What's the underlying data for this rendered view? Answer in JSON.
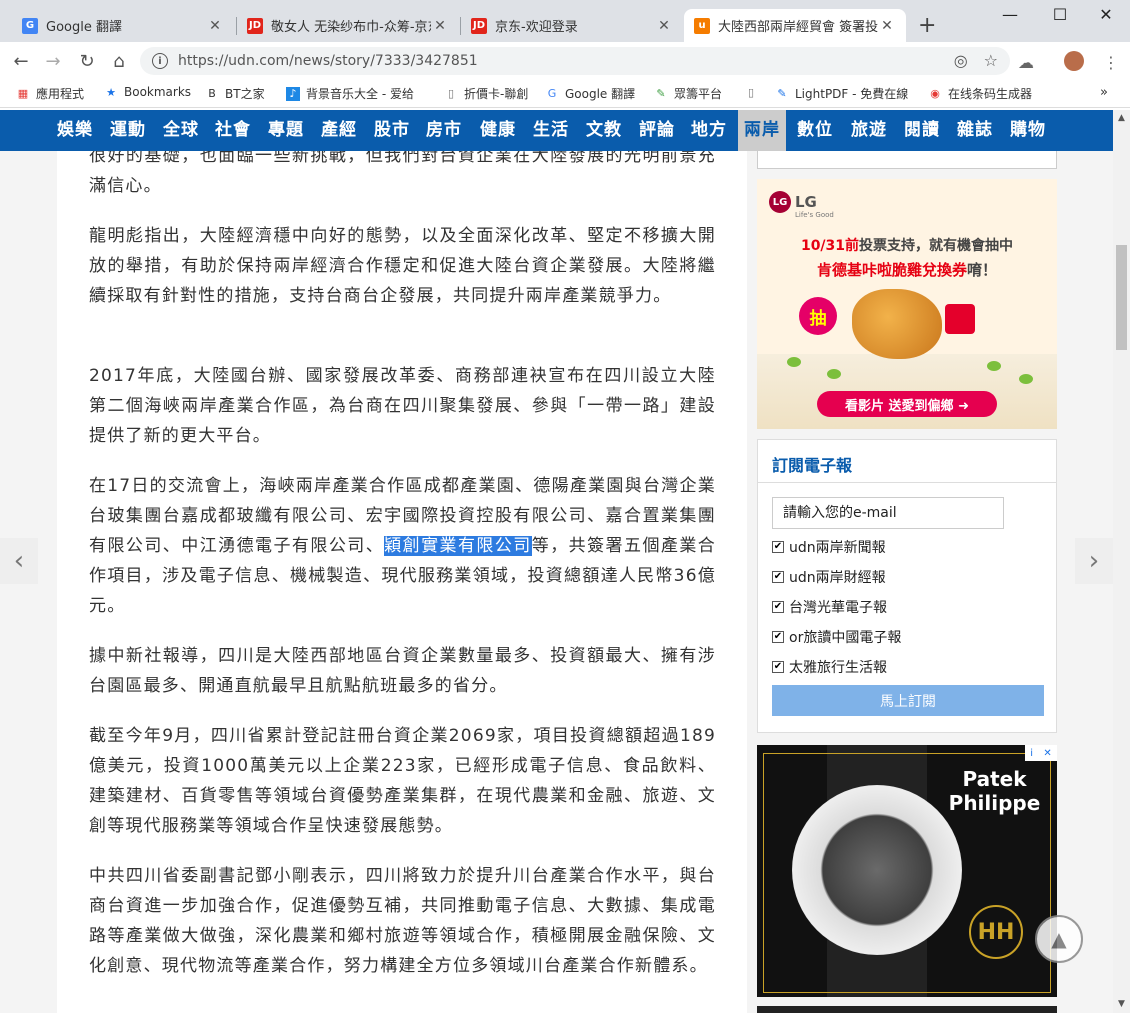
{
  "browser": {
    "tabs": [
      {
        "title": "Google 翻譯",
        "favicon": "google-translate-icon",
        "color": "#4285f4"
      },
      {
        "title": "敬女人 无染纱布巾-众筹-京东",
        "favicon": "jd-icon",
        "color": "#e1251b"
      },
      {
        "title": "京东-欢迎登录",
        "favicon": "jd-icon",
        "color": "#e1251b"
      },
      {
        "title": "大陸西部兩岸經貿會 簽署投資",
        "favicon": "udn-icon",
        "color": "#f57c00"
      }
    ],
    "url": "https://udn.com/news/story/7333/3427851",
    "bookmarks": [
      "應用程式",
      "Bookmarks",
      "BT之家",
      "背景音乐大全 - 爱给",
      "折價卡-聯創",
      "Google 翻譯",
      "眾籌平台",
      "LightPDF - 免費在線",
      "在线条码生成器"
    ]
  },
  "nav": {
    "categories": [
      "娛樂",
      "運動",
      "全球",
      "社會",
      "專題",
      "產經",
      "股市",
      "房市",
      "健康",
      "生活",
      "文教",
      "評論",
      "地方",
      "兩岸",
      "數位",
      "旅遊",
      "閱讀",
      "雜誌",
      "購物"
    ],
    "active": "兩岸"
  },
  "article": {
    "p0": "很好的基礎，也面臨一些新挑戰，但我們對台資企業在大陸發展的光明前景充滿信心。",
    "p1": "龍明彪指出，大陸經濟穩中向好的態勢，以及全面深化改革、堅定不移擴大開放的舉措，有助於保持兩岸經濟合作穩定和促進大陸台資企業發展。大陸將繼續採取有針對性的措施，支持台商台企發展，共同提升兩岸產業競爭力。",
    "p2": "2017年底，大陸國台辦、國家發展改革委、商務部連袂宣布在四川設立大陸第二個海峽兩岸產業合作區，為台商在四川聚集發展、參與「一帶一路」建設提供了新的更大平台。",
    "p3_before": "在17日的交流會上，海峽兩岸產業合作區成都產業園、德陽產業園與台灣企業台玻集團台嘉成都玻纖有限公司、宏宇國際投資控股有限公司、嘉合置業集團有限公司、中江湧德電子有限公司、",
    "p3_highlight": "穎創實業有限公司",
    "p3_after": "等，共簽署五個產業合作項目，涉及電子信息、機械製造、現代服務業領域，投資總額達人民幣36億元。",
    "p4": "據中新社報導，四川是大陸西部地區台資企業數量最多、投資額最大、擁有涉台園區最多、開通直航最早且航點航班最多的省分。",
    "p5": "截至今年9月，四川省累計登記註冊台資企業2069家，項目投資總額超過189億美元，投資1000萬美元以上企業223家，已經形成電子信息、食品飲料、建築建材、百貨零售等領域台資優勢產業集群，在現代農業和金融、旅遊、文創等現代服務業等領域合作呈快速發展態勢。",
    "p6": "中共四川省委副書記鄧小剛表示，四川將致力於提升川台產業合作水平，與台商台資進一步加強合作，促進優勢互補，共同推動電子信息、大數據、集成電路等產業做大做強，深化農業和鄉村旅遊等領域合作，積極開展金融保險、文化創意、現代物流等產業合作，努力構建全方位多領域川台產業合作新體系。"
  },
  "ad_lg": {
    "brand": "LG",
    "tagline": "Life's Good",
    "line1_red": "10/31前",
    "line1_rest": "投票支持，就有機會抽中",
    "line2_red": "肯德基咔啦脆雞兌換券",
    "line2_rest": "唷！",
    "badge": "抽",
    "cta": "看影片 送愛到偏鄉 ➜"
  },
  "subscribe": {
    "title": "訂閱電子報",
    "placeholder": "請輸入您的e-mail",
    "options": [
      "udn兩岸新聞報",
      "udn兩岸財經報",
      "台灣光華電子報",
      "or旅讀中國電子報",
      "太雅旅行生活報"
    ],
    "button": "馬上訂閱"
  },
  "ad_patek": {
    "brand": "Patek Philippe",
    "badge": "HH"
  }
}
